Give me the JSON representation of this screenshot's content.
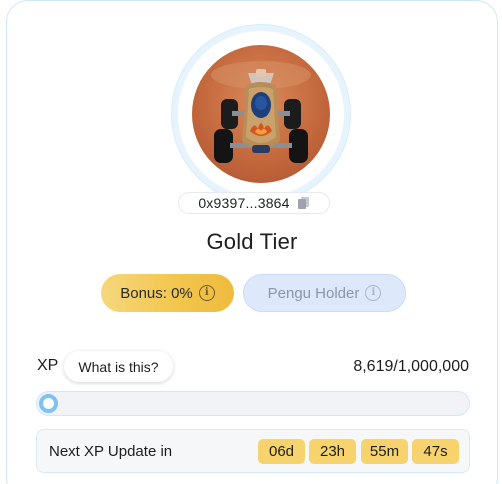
{
  "profile": {
    "address": "0x9397...3864",
    "tier": "Gold Tier"
  },
  "badges": {
    "bonus_label": "Bonus: 0%",
    "holder_label": "Pengu Holder"
  },
  "xp": {
    "label": "XP",
    "help_label": "What is this?",
    "value_text": "8,619/1,000,000",
    "current": 8619,
    "max": 1000000,
    "progress_fraction": 0.008619
  },
  "update": {
    "label": "Next XP Update in",
    "days": "06d",
    "hours": "23h",
    "minutes": "55m",
    "seconds": "47s"
  },
  "colors": {
    "gold": "#f3c64f",
    "holder_bg": "#dde9fb",
    "ring": "#e8f4fd",
    "progress_accent": "#7cc3f2",
    "timer_bg": "#f7d36e"
  },
  "icons": {
    "copy": "copy-icon",
    "info": "info-icon"
  }
}
